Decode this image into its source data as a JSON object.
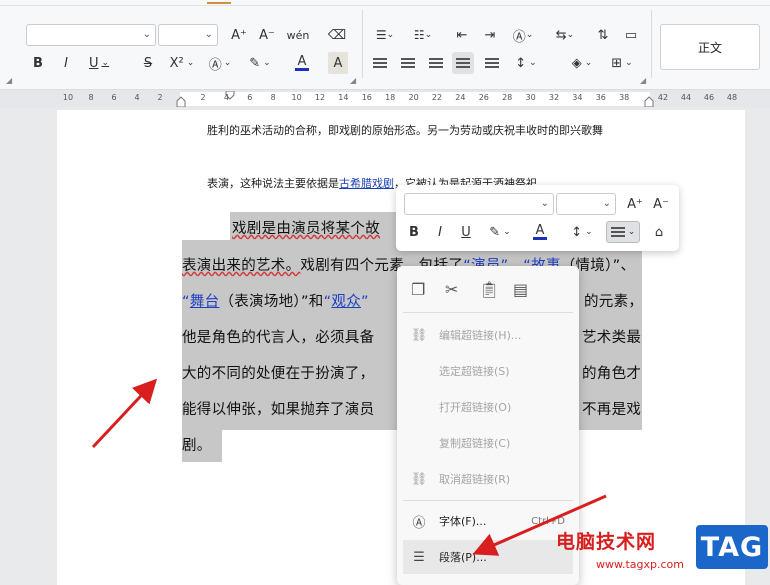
{
  "ribbon": {
    "font_name_value": "",
    "font_size_value": "",
    "style_preview_label": "正文",
    "buttons": {
      "grow_font": "A⁺",
      "shrink_font": "A⁻",
      "phonetic": "wén",
      "bold": "B",
      "italic": "I",
      "underline": "U",
      "strikethrough": "S",
      "superscript": "X²",
      "font_color_letter": "A",
      "char_shading": "A"
    }
  },
  "ruler": {
    "left_numbers": [
      "10",
      "8",
      "6",
      "4",
      "2"
    ],
    "numbers": [
      "2",
      "4",
      "6",
      "8",
      "10",
      "12",
      "14",
      "16",
      "18",
      "20",
      "22",
      "24",
      "26",
      "28",
      "30",
      "32",
      "34",
      "36",
      "38"
    ],
    "right_numbers": [
      "42",
      "44",
      "46",
      "48"
    ]
  },
  "document": {
    "line1": "胜利的巫术活动的合称，即戏剧的原始形态。另一为劳动或庆祝丰收时的即兴歌舞",
    "line2_a": "表演，这种说法主要依据是",
    "line2_link": "古希腊戏剧",
    "line2_b": "，它被认为是起源于酒神祭祀",
    "para": {
      "l1": "戏剧是由演员将某个故",
      "l2_a": "表演出来的艺术。",
      "l2_b": "戏剧有四个元素，包括了",
      "l2_q1": "“演员”",
      "l2_dun1": "、",
      "l2_q2a": "“",
      "l2_q2b": "故事",
      "l2_q2c": "（情境）”",
      "l2_dun2": "、",
      "l3_q3a": "“",
      "l3_q3b": "舞台",
      "l3_q3c": "（表演场地）”和",
      "l3_q4a": "“",
      "l3_q4b": "观众",
      "l3_q4c": "”",
      "l3_end": "的元素，",
      "l4_a": "他是角色的代言人，必须具备",
      "l4_end": "艺术类最",
      "l5_a": "大的不同的处便在于扮演了，",
      "l5_end": "的角色才",
      "l6_a": "能得以伸张，如果抛弃了演员",
      "l6_end": "不再是戏",
      "l7": "剧。"
    }
  },
  "float_toolbar": {
    "font_name_value": "",
    "font_size_value": "",
    "grow": "A⁺",
    "shrink": "A⁻",
    "bold": "B",
    "italic": "I",
    "underline": "U",
    "font_color_letter": "A"
  },
  "context_menu": {
    "items": [
      {
        "label": "编辑超链接(H)...",
        "enabled": false
      },
      {
        "label": "选定超链接(S)",
        "enabled": false
      },
      {
        "label": "打开超链接(O)",
        "enabled": false
      },
      {
        "label": "复制超链接(C)",
        "enabled": false
      },
      {
        "label": "取消超链接(R)",
        "enabled": false
      },
      {
        "label": "字体(F)...",
        "shortcut": "Ctrl+D",
        "enabled": true
      },
      {
        "label": "段落(P)...",
        "enabled": true
      }
    ]
  },
  "watermark": {
    "site_name": "电脑技术网",
    "url": "www.tagxp.com",
    "tag": "TAG"
  },
  "colors": {
    "accent_red": "#d81e1e",
    "link_blue": "#1a3fb5",
    "selection_gray": "#c7c7c7",
    "font_color_bar": "#1f2fb8",
    "tag_blue": "#1b66c9"
  }
}
